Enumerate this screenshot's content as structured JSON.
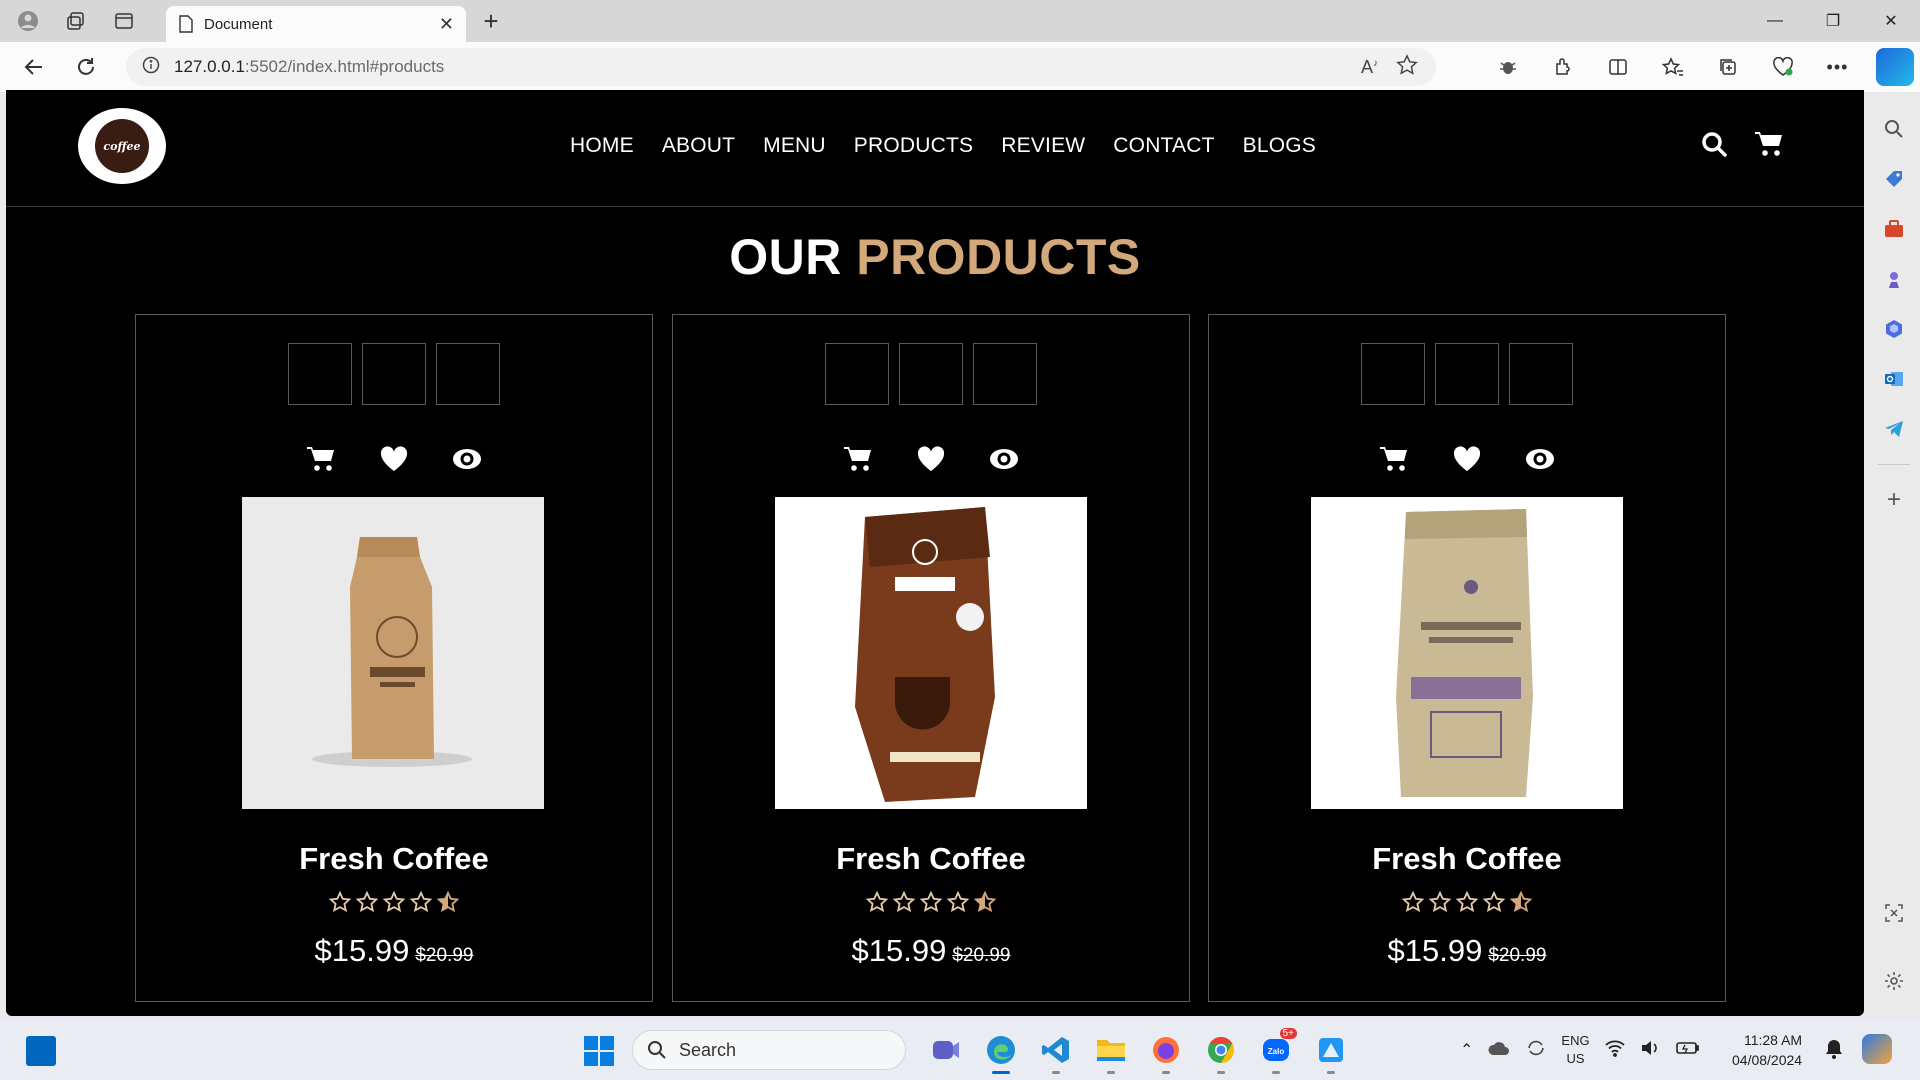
{
  "browser": {
    "tab_title": "Document",
    "url_host": "127.0.0.1",
    "url_path": ":5502/index.html#products"
  },
  "site": {
    "logo_text": "coffee",
    "nav": [
      "HOME",
      "ABOUT",
      "MENU",
      "PRODUCTS",
      "REVIEW",
      "CONTACT",
      "BLOGS"
    ],
    "section_title_part1": "OUR",
    "section_title_part2": "PRODUCTS",
    "accent_color": "#d3a87b"
  },
  "products": [
    {
      "name": "Fresh Coffee",
      "price": "$15.99",
      "old_price": "$20.99",
      "rating": 4.5
    },
    {
      "name": "Fresh Coffee",
      "price": "$15.99",
      "old_price": "$20.99",
      "rating": 4.5
    },
    {
      "name": "Fresh Coffee",
      "price": "$15.99",
      "old_price": "$20.99",
      "rating": 4.5
    }
  ],
  "taskbar": {
    "search_placeholder": "Search",
    "lang_line1": "ENG",
    "lang_line2": "US",
    "time": "11:28 AM",
    "date": "04/08/2024",
    "zalo_badge": "5+"
  }
}
